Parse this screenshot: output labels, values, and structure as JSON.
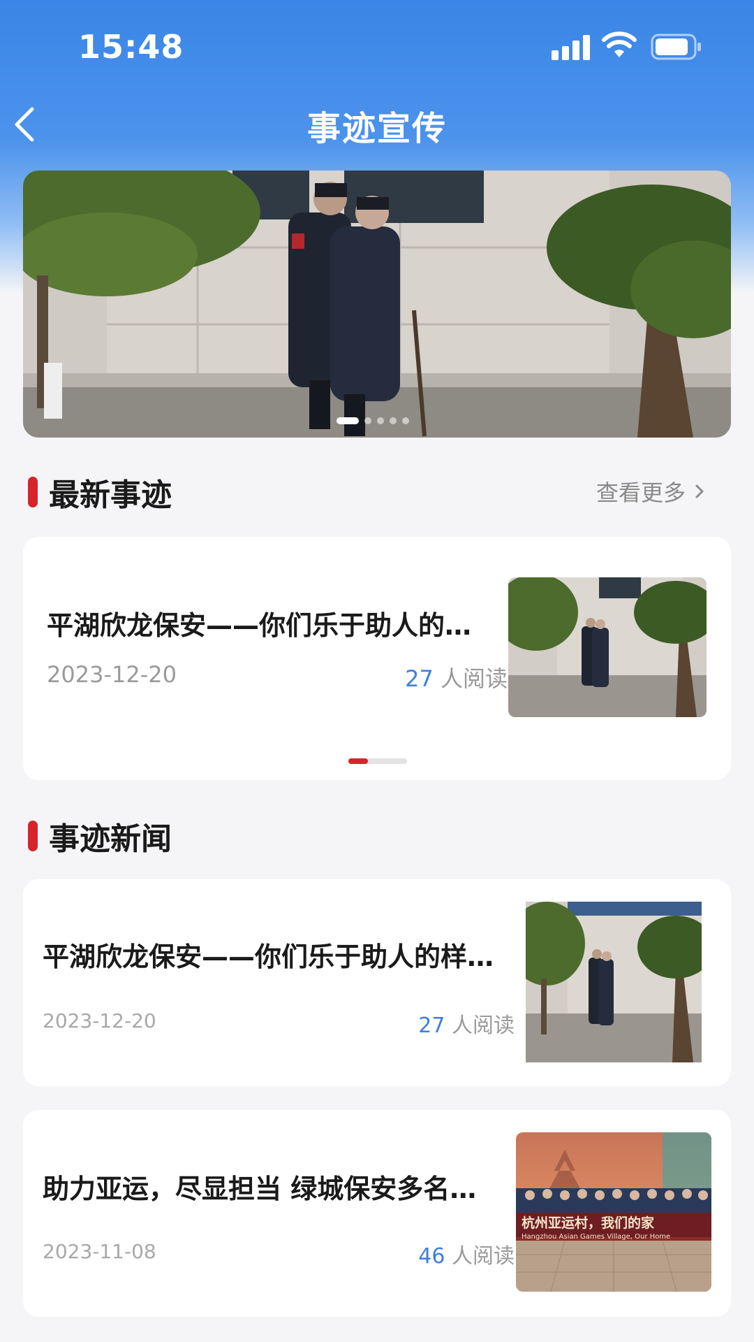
{
  "status": {
    "time": "15:48"
  },
  "nav": {
    "title": "事迹宣传"
  },
  "latest": {
    "heading": "最新事迹",
    "more_label": "查看更多",
    "item": {
      "title": "平湖欣龙保安——你们乐于助人的…",
      "date": "2023-12-20",
      "reads": "27",
      "reads_suffix": " 人阅读"
    }
  },
  "news": {
    "heading": "事迹新闻",
    "items": [
      {
        "title": "平湖欣龙保安——你们乐于助人的样…",
        "date": "2023-12-20",
        "reads": "27",
        "reads_suffix": "  人阅读"
      },
      {
        "title": "助力亚运，尽显担当 绿城保安多名…",
        "date": "2023-11-08",
        "reads": "46",
        "reads_suffix": "  人阅读",
        "image_caption": "杭州亚运村，我们的家",
        "image_caption_en": "Hangzhou Asian Games Village, Our Home"
      }
    ]
  },
  "colors": {
    "accent_red": "#d8232a",
    "link_blue": "#3f7ee0",
    "header_blue": "#3a85e6"
  }
}
